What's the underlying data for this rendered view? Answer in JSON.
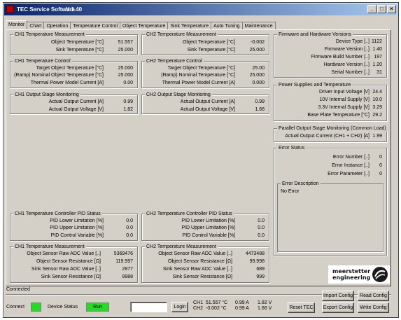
{
  "window": {
    "title": "TEC Service Software",
    "version": "V 1.40",
    "btn_min": "_",
    "btn_max": "□",
    "btn_close": "×"
  },
  "tabs": [
    {
      "label": "Monitor"
    },
    {
      "label": "Chart"
    },
    {
      "label": "Operation"
    },
    {
      "label": "Temperature Control"
    },
    {
      "label": "Object Temperature"
    },
    {
      "label": "Sink Temperature"
    },
    {
      "label": "Auto Tuning"
    },
    {
      "label": "Maintenance"
    }
  ],
  "ch1_meas": {
    "title": "CH1 Temperature Measurement",
    "rows": [
      {
        "label": "Object Temperature [°C]",
        "value": "51.557"
      },
      {
        "label": "Sink Temperature [°C]",
        "value": "25.000"
      }
    ]
  },
  "ch2_meas": {
    "title": "CH2 Temperature Measurement",
    "rows": [
      {
        "label": "Object Temperature [°C]",
        "value": "-0.002"
      },
      {
        "label": "Sink Temperature [°C]",
        "value": "25.000"
      }
    ]
  },
  "ch1_ctrl": {
    "title": "CH1 Temperature Control",
    "rows": [
      {
        "label": "Target Object Temperature [°C]",
        "value": "25.000"
      },
      {
        "label": "(Ramp) Nominal Object Temperature [°C]",
        "value": "25.000"
      },
      {
        "label": "Thermal Power Model Current [A]",
        "value": "0.00"
      }
    ]
  },
  "ch2_ctrl": {
    "title": "CH2 Temperature Control",
    "rows": [
      {
        "label": "Target Object Temperature [°C]",
        "value": "25.00"
      },
      {
        "label": "(Ramp) Nominal Temperature [°C]",
        "value": "25.000"
      },
      {
        "label": "Thermal Power Model Current [A]",
        "value": "0.000"
      }
    ]
  },
  "ch1_out": {
    "title": "CH1 Output Stage Monitoring",
    "rows": [
      {
        "label": "Actual Output Current [A]",
        "value": "0.99"
      },
      {
        "label": "Actual Output Voltage [V]",
        "value": "1.82"
      }
    ]
  },
  "ch2_out": {
    "title": "CH2 Output Stage Monitoring",
    "rows": [
      {
        "label": "Actual Output Current [A]",
        "value": "0.99"
      },
      {
        "label": "Actual Output Voltage [V]",
        "value": "1.66"
      }
    ]
  },
  "ch1_pid": {
    "title": "CH1 Temperature Controller PID Status",
    "rows": [
      {
        "label": "PID Lower Limitation [%]",
        "value": "0.0"
      },
      {
        "label": "PID Upper Limitation [%]",
        "value": "0.0"
      },
      {
        "label": "PID Control Variable [%]",
        "value": "0.0"
      }
    ]
  },
  "ch2_pid": {
    "title": "CH2 Temperature Controller PID Status",
    "rows": [
      {
        "label": "PID Lower Limitation [%]",
        "value": "0.0"
      },
      {
        "label": "PID Upper Limitation [%]",
        "value": "0.0"
      },
      {
        "label": "PID Control Variable [%]",
        "value": "0.0"
      }
    ]
  },
  "ch1_raw": {
    "title": "CH1 Temperature Measurement",
    "rows": [
      {
        "label": "Object Sensor Raw ADC Value [..]",
        "value": "5369476"
      },
      {
        "label": "Object Sensor Resistance [Ω]",
        "value": "119.997"
      },
      {
        "label": "Sink Sensor Raw ADC Value [..]",
        "value": "2877"
      },
      {
        "label": "Sink Sensor Resistance [Ω]",
        "value": "9988"
      }
    ]
  },
  "ch2_raw": {
    "title": "CH2 Temperature Measurement",
    "rows": [
      {
        "label": "Object Sensor Raw ADC Value [..]",
        "value": "4473488"
      },
      {
        "label": "Object Sensor Resistance [Ω]",
        "value": "99.998"
      },
      {
        "label": "Sink Sensor Raw ADC Value [..]",
        "value": "689"
      },
      {
        "label": "Sink Sensor Resistance [Ω]",
        "value": "999"
      }
    ]
  },
  "fw": {
    "title": "Firmware and Hardware Versions",
    "rows": [
      {
        "label": "Device Type [..]",
        "value": "1122"
      },
      {
        "label": "Firmware Version [..]",
        "value": "1.40"
      },
      {
        "label": "Firmware Build Number [..]",
        "value": "197"
      },
      {
        "label": "Hardware Version [..]",
        "value": "1.20"
      },
      {
        "label": "Serial Number [..]",
        "value": "31"
      }
    ]
  },
  "power": {
    "title": "Power Supplies and Temperature",
    "rows": [
      {
        "label": "Driver Input Voltage [V]",
        "value": "24.4"
      },
      {
        "label": "10V Internal Supply [V]",
        "value": "10.0"
      },
      {
        "label": "3.3V Internal Supply [V]",
        "value": "3.29"
      },
      {
        "label": "Base Plate Temperature [°C]",
        "value": "29.2"
      }
    ]
  },
  "parallel": {
    "title": "Parallel Output Stage Monitoring (Common Load)",
    "rows": [
      {
        "label": "Actual Output Current (CH1 + CH2) [A]",
        "value": "1.99"
      }
    ]
  },
  "error": {
    "title": "Error Status",
    "rows": [
      {
        "label": "Error Number [..]",
        "value": "0"
      },
      {
        "label": "Error Instance [..]",
        "value": "0"
      },
      {
        "label": "Error Parameter [..]",
        "value": "0"
      }
    ],
    "desc_title": "Error Description",
    "desc_text": "No Error"
  },
  "logo": {
    "line1": "meerstetter",
    "line2": "engineering"
  },
  "status": {
    "connected_text": "Connected",
    "connect_label": "Connect",
    "device_status_label": "Device Status",
    "device_status_value": "Run",
    "login_input": "",
    "login_btn": "Login",
    "ch1_label": "CH1",
    "ch1_temp": "51.557 °C",
    "ch1_current": "0.99 A",
    "ch1_voltage": "1.82 V",
    "ch2_label": "CH2",
    "ch2_temp": "-0.002 °C",
    "ch2_current": "0.99 A",
    "ch2_voltage": "1.66 V",
    "reset_btn": "Reset TEC",
    "import_btn": "Import Config",
    "export_btn": "Export Config",
    "read_btn": "Read Config",
    "write_btn": "Write Config"
  },
  "colors": {
    "led_green": "#22dd22",
    "title_blue": "#0a246a"
  }
}
